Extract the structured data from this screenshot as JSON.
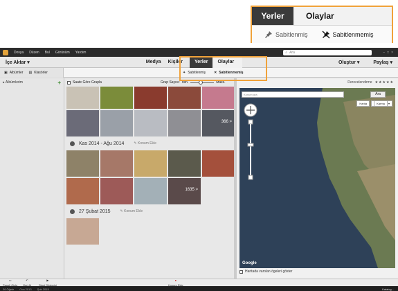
{
  "callout": {
    "tab_active": "Yerler",
    "tab_other": "Olaylar",
    "pinned": "Sabitlenmiş",
    "unpinned": "Sabitlenmemiş"
  },
  "menubar": {
    "items": [
      "Dosya",
      "Düzen",
      "Bul",
      "Görünüm",
      "Yardım"
    ],
    "search_placeholder": "Ara"
  },
  "toolbar": {
    "import": "İçe Aktar",
    "nav": [
      "Medya",
      "Kişiler"
    ],
    "places": "Yerler",
    "events": "Olaylar",
    "create": "Oluştur",
    "share": "Paylaş"
  },
  "subbar": {
    "albums": "Albümler",
    "folders": "Klasörler",
    "pinned": "Sabitlenmiş",
    "unpinned": "Sabitlenmemiş"
  },
  "left": {
    "my_albums": "Albümlerim"
  },
  "center": {
    "group_by_time": "Saate Göre Grupla",
    "group_count": "Grup Sayısı:",
    "group_min": "Min.",
    "group_max": "Maks.",
    "sections": [
      {
        "title": "Kas 2014 - Ağu 2014",
        "add_location": "Konum Ekle"
      },
      {
        "title": "27 Şubat 2015",
        "add_location": "Konum Ekle"
      }
    ],
    "counts": [
      "366 >",
      "1635 >"
    ]
  },
  "right": {
    "rating": "Derecelendirme",
    "rating_value": "★★★★★",
    "search_placeholder": "Konum ara",
    "search_button": "Ara",
    "map_types": [
      "Harita",
      "Karma"
    ],
    "show_only": "Haritada varolan ögeleri göster"
  },
  "bottombar": {
    "panel": "Paneli Gizle",
    "undo": "Geri Al",
    "slideshow": "Slayt Gösterisi",
    "add_location": "Konum Ekle"
  },
  "statusbar": {
    "items": [
      "36 Öğele",
      "Oca 2013",
      "Şub 2015"
    ],
    "catalog": "Katalog..."
  },
  "colors": {
    "accent": "#f0a23a",
    "dark": "#2b2b2b"
  }
}
